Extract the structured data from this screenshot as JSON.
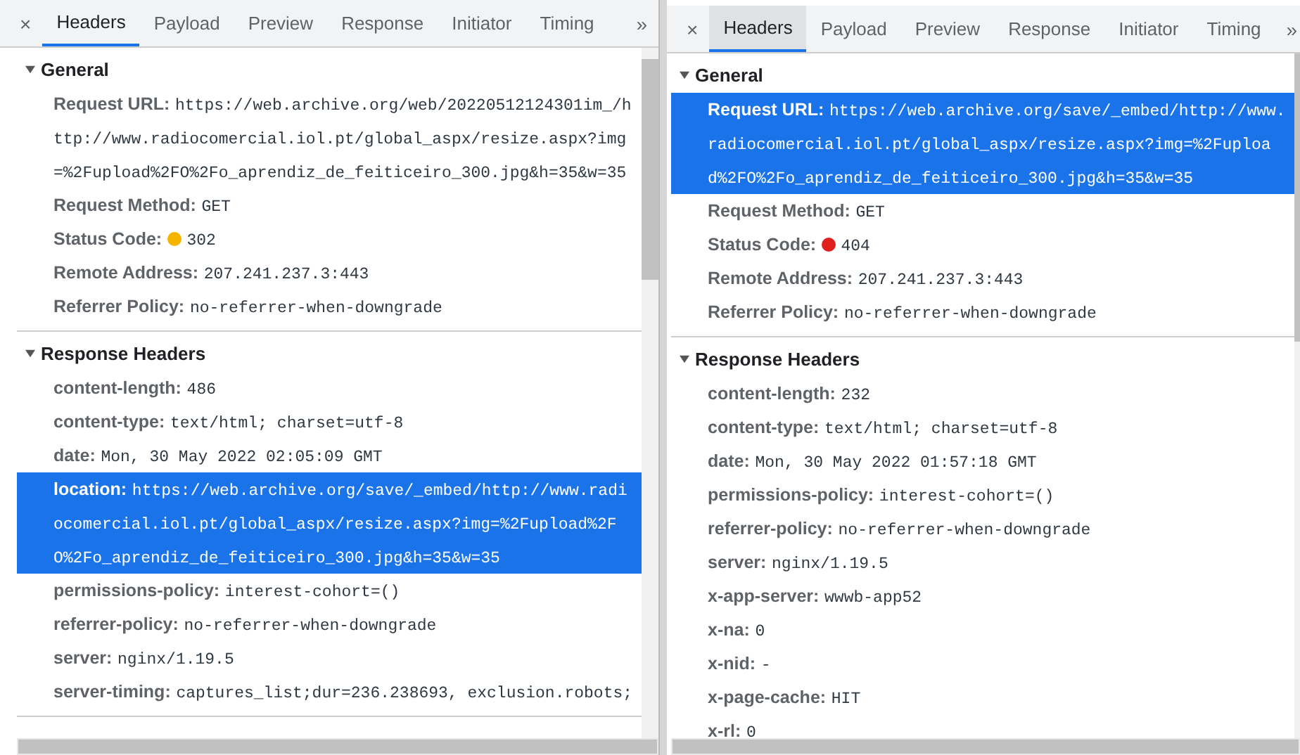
{
  "panels": [
    {
      "close": "×",
      "more": "»",
      "tabs": [
        {
          "label": "Headers",
          "selected": true
        },
        {
          "label": "Payload",
          "selected": false
        },
        {
          "label": "Preview",
          "selected": false
        },
        {
          "label": "Response",
          "selected": false
        },
        {
          "label": "Initiator",
          "selected": false
        },
        {
          "label": "Timing",
          "selected": false
        }
      ],
      "sections": [
        {
          "title": "General",
          "expanded": true,
          "rows": [
            {
              "kind": "text",
              "name": "Request URL:",
              "value": "https://web.archive.org/web/20220512124301im_/http://www.radiocomercial.iol.pt/global_aspx/resize.aspx?img=%2Fupload%2FO%2Fo_aprendiz_de_feiticeiro_300.jpg&h=35&w=35",
              "selected": false
            },
            {
              "kind": "text",
              "name": "Request Method:",
              "value": "GET",
              "selected": false
            },
            {
              "kind": "status",
              "name": "Status Code:",
              "value": "302",
              "color": "#f5b400",
              "selected": false
            },
            {
              "kind": "text",
              "name": "Remote Address:",
              "value": "207.241.237.3:443",
              "selected": false
            },
            {
              "kind": "text",
              "name": "Referrer Policy:",
              "value": "no-referrer-when-downgrade",
              "selected": false
            }
          ]
        },
        {
          "title": "Response Headers",
          "expanded": true,
          "rows": [
            {
              "kind": "text",
              "name": "content-length:",
              "value": "486",
              "selected": false
            },
            {
              "kind": "text",
              "name": "content-type:",
              "value": "text/html; charset=utf-8",
              "selected": false
            },
            {
              "kind": "text",
              "name": "date:",
              "value": "Mon, 30 May 2022 02:05:09 GMT",
              "selected": false
            },
            {
              "kind": "text",
              "name": "location:",
              "value": "https://web.archive.org/save/_embed/http://www.radiocomercial.iol.pt/global_aspx/resize.aspx?img=%2Fupload%2FO%2Fo_aprendiz_de_feiticeiro_300.jpg&h=35&w=35",
              "selected": true
            },
            {
              "kind": "text",
              "name": "permissions-policy:",
              "value": "interest-cohort=()",
              "selected": false
            },
            {
              "kind": "text",
              "name": "referrer-policy:",
              "value": "no-referrer-when-downgrade",
              "selected": false
            },
            {
              "kind": "text",
              "name": "server:",
              "value": "nginx/1.19.5",
              "selected": false
            },
            {
              "kind": "text",
              "name": "server-timing:",
              "value": "captures_list;dur=236.238693, exclusion.robots;",
              "selected": false
            }
          ]
        }
      ]
    },
    {
      "close": "×",
      "more": "»",
      "tabs": [
        {
          "label": "Headers",
          "selected": true
        },
        {
          "label": "Payload",
          "selected": false
        },
        {
          "label": "Preview",
          "selected": false
        },
        {
          "label": "Response",
          "selected": false
        },
        {
          "label": "Initiator",
          "selected": false
        },
        {
          "label": "Timing",
          "selected": false
        }
      ],
      "sections": [
        {
          "title": "General",
          "expanded": true,
          "rows": [
            {
              "kind": "text",
              "name": "Request URL:",
              "value": "https://web.archive.org/save/_embed/http://www.radiocomercial.iol.pt/global_aspx/resize.aspx?img=%2Fupload%2FO%2Fo_aprendiz_de_feiticeiro_300.jpg&h=35&w=35",
              "selected": true
            },
            {
              "kind": "text",
              "name": "Request Method:",
              "value": "GET",
              "selected": false
            },
            {
              "kind": "status",
              "name": "Status Code:",
              "value": "404",
              "color": "#e0201c",
              "selected": false
            },
            {
              "kind": "text",
              "name": "Remote Address:",
              "value": "207.241.237.3:443",
              "selected": false
            },
            {
              "kind": "text",
              "name": "Referrer Policy:",
              "value": "no-referrer-when-downgrade",
              "selected": false
            }
          ]
        },
        {
          "title": "Response Headers",
          "expanded": true,
          "rows": [
            {
              "kind": "text",
              "name": "content-length:",
              "value": "232",
              "selected": false
            },
            {
              "kind": "text",
              "name": "content-type:",
              "value": "text/html; charset=utf-8",
              "selected": false
            },
            {
              "kind": "text",
              "name": "date:",
              "value": "Mon, 30 May 2022 01:57:18 GMT",
              "selected": false
            },
            {
              "kind": "text",
              "name": "permissions-policy:",
              "value": "interest-cohort=()",
              "selected": false
            },
            {
              "kind": "text",
              "name": "referrer-policy:",
              "value": "no-referrer-when-downgrade",
              "selected": false
            },
            {
              "kind": "text",
              "name": "server:",
              "value": "nginx/1.19.5",
              "selected": false
            },
            {
              "kind": "text",
              "name": "x-app-server:",
              "value": "wwwb-app52",
              "selected": false
            },
            {
              "kind": "text",
              "name": "x-na:",
              "value": "0",
              "selected": false
            },
            {
              "kind": "text",
              "name": "x-nid:",
              "value": "-",
              "selected": false
            },
            {
              "kind": "text",
              "name": "x-page-cache:",
              "value": "HIT",
              "selected": false
            },
            {
              "kind": "text",
              "name": "x-rl:",
              "value": "0",
              "selected": false
            }
          ]
        }
      ]
    }
  ]
}
